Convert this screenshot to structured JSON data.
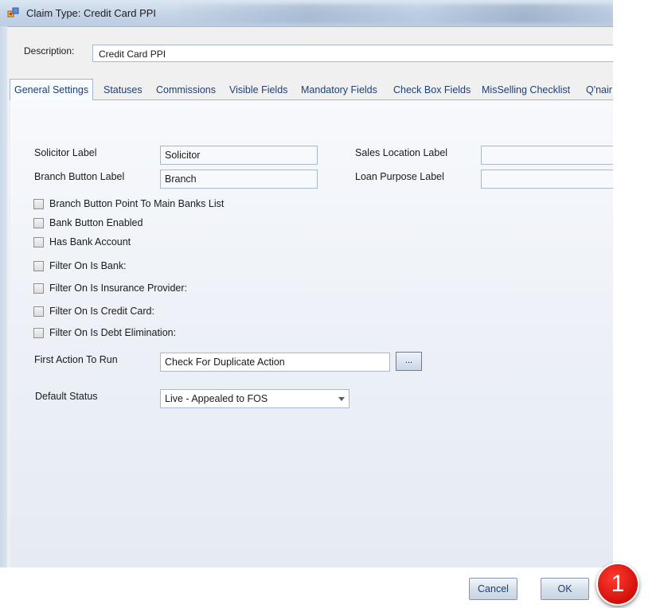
{
  "window": {
    "title": "Claim Type: Credit Card PPI"
  },
  "description": {
    "label": "Description:",
    "value": "Credit Card PPI"
  },
  "tabs": [
    {
      "label": "General Settings",
      "active": true
    },
    {
      "label": "Statuses"
    },
    {
      "label": "Commissions"
    },
    {
      "label": "Visible Fields"
    },
    {
      "label": "Mandatory Fields"
    },
    {
      "label": "Check Box Fields"
    },
    {
      "label": "MisSelling Checklist"
    },
    {
      "label": "Q'nair"
    }
  ],
  "fields": {
    "solicitor_label": {
      "label": "Solicitor Label",
      "value": "Solicitor"
    },
    "branch_button_label": {
      "label": "Branch Button Label",
      "value": "Branch"
    },
    "sales_location_label": {
      "label": "Sales Location Label",
      "value": ""
    },
    "loan_purpose_label": {
      "label": "Loan Purpose Label",
      "value": ""
    },
    "first_action": {
      "label": "First Action To Run",
      "value": "Check For Duplicate Action",
      "browse_label": "..."
    },
    "default_status": {
      "label": "Default Status",
      "value": "Live - Appealed to FOS"
    }
  },
  "checkboxes": [
    {
      "label": "Branch Button Point To Main Banks List",
      "checked": false
    },
    {
      "label": "Bank Button Enabled",
      "checked": false
    },
    {
      "label": "Has Bank Account",
      "checked": false
    },
    {
      "label": "Filter On Is Bank:",
      "checked": false
    },
    {
      "label": "Filter On Is Insurance Provider:",
      "checked": false
    },
    {
      "label": "Filter On Is Credit Card:",
      "checked": false
    },
    {
      "label": "Filter On Is Debt Elimination:",
      "checked": false
    }
  ],
  "buttons": {
    "cancel": "Cancel",
    "ok": "OK"
  },
  "annotation": {
    "step": "1"
  },
  "colors": {
    "tab_text": "#1f3f73",
    "badge": "#d2100a"
  }
}
